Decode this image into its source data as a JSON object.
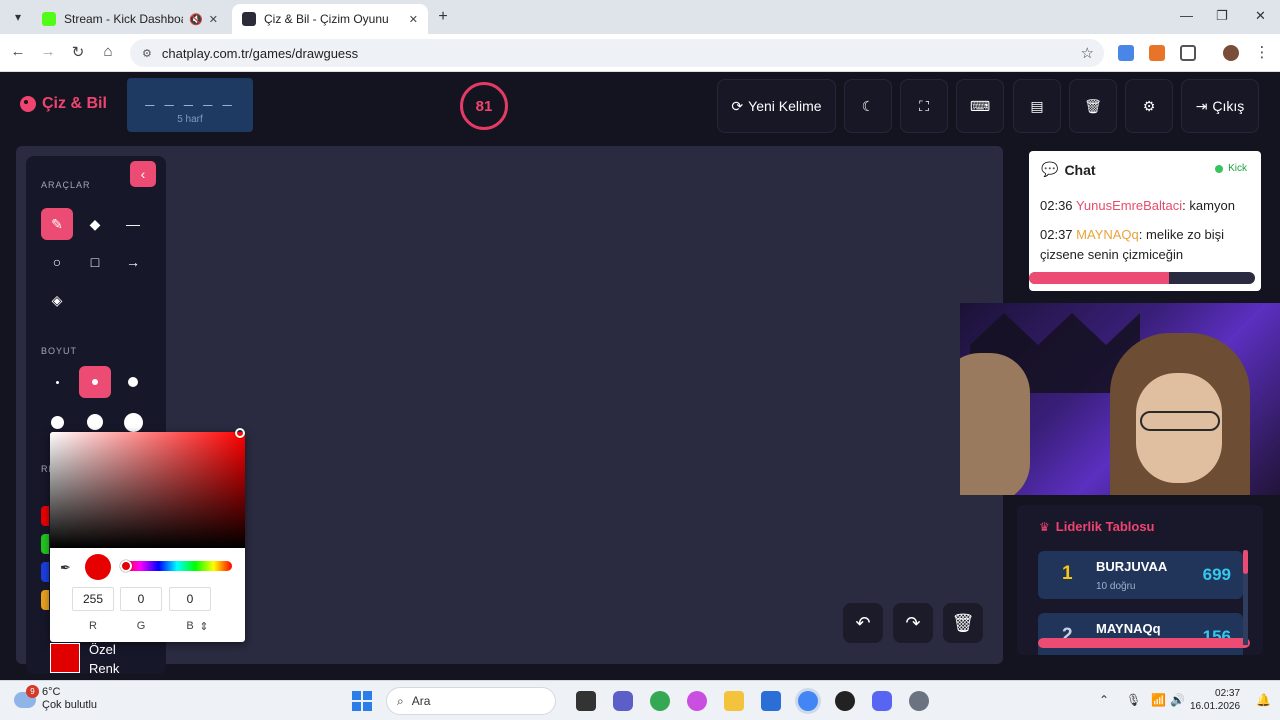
{
  "browser": {
    "tabs": [
      {
        "title": "Stream - Kick Dashboard",
        "state": "inactive"
      },
      {
        "title": "Çiz & Bil - Çizim Oyunu",
        "state": "active"
      }
    ],
    "url": "chatplay.com.tr/games/drawguess"
  },
  "header": {
    "logo": "Çiz & Bil",
    "word_blanks": "_ _ _ _ _",
    "word_length": "5 harf",
    "timer": "81",
    "buttons": {
      "new_word": "Yeni Kelime",
      "logout": "Çıkış"
    }
  },
  "tools": {
    "tools_label": "ARAÇLAR",
    "size_label": "BOYUT",
    "color_label": "RE",
    "custom_color_line1": "Özel",
    "custom_color_line2": "Renk"
  },
  "color_picker": {
    "r": "255",
    "g": "0",
    "b": "0",
    "r_label": "R",
    "g_label": "G",
    "b_label": "B",
    "selected_color": "#e60000"
  },
  "chat": {
    "title": "Chat",
    "platform": "Kick",
    "messages": [
      {
        "time": "02:36",
        "user": "YunusEmreBaltaci",
        "user_color": "#e94b6b",
        "text": "kamyon"
      },
      {
        "time": "02:37",
        "user": "MAYNAQq",
        "user_color": "#e8a33b",
        "text": "melike zo bişi çizsene senin çizmiceğin"
      }
    ]
  },
  "leaderboard": {
    "title": "Liderlik Tablosu",
    "entries": [
      {
        "rank": "1",
        "name": "BURJUVAA",
        "correct": "10 doğru",
        "score": "699",
        "rank_color": "#f5c518"
      },
      {
        "rank": "2",
        "name": "MAYNAQq",
        "correct": "",
        "score": "156",
        "rank_color": "#c7d1e0"
      }
    ]
  },
  "taskbar": {
    "temperature": "6°C",
    "weather": "Çok bulutlu",
    "weather_badge": "9",
    "search": "Ara",
    "time": "02:37",
    "date": "16.01.2026"
  }
}
